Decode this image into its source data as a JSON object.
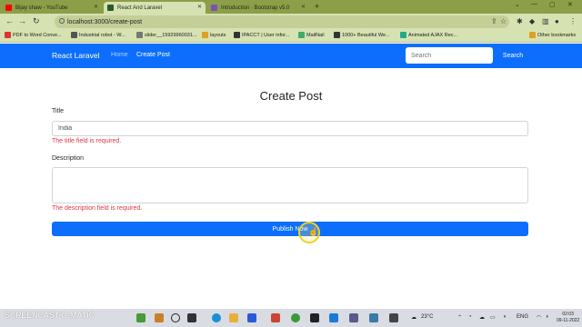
{
  "browser": {
    "tabs": [
      {
        "title": "Bijay shaw - YouTube",
        "favicon_color": "#ff0000"
      },
      {
        "title": "React And Laravel",
        "favicon_color": "#2a5a2a"
      },
      {
        "title": "Introduction · Bootstrap v5.0",
        "favicon_color": "#7952b3"
      }
    ],
    "url": "localhost:3000/create-post",
    "bookmarks": [
      {
        "label": "PDF to Word Conve...",
        "color": "#d33"
      },
      {
        "label": "Industrial robot - W...",
        "color": "#555"
      },
      {
        "label": "slider__15929960031...",
        "color": "#777"
      },
      {
        "label": "layouts",
        "color": "#e0a020"
      },
      {
        "label": "IPACCT | User infor...",
        "color": "#333"
      },
      {
        "label": "MailNail",
        "color": "#4a6"
      },
      {
        "label": "1000+ Beautiful We...",
        "color": "#333"
      },
      {
        "label": "Animated AJAX Rec...",
        "color": "#2a8"
      },
      {
        "label": "Other bookmarks",
        "color": "#e0a020"
      }
    ]
  },
  "navbar": {
    "brand": "React Laravel",
    "links": [
      "Home",
      "Create Post"
    ],
    "search_placeholder": "Search",
    "search_button": "Search"
  },
  "form": {
    "heading": "Create Post",
    "title_label": "Title",
    "title_value": "India",
    "title_error": "The title field is required.",
    "description_label": "Description",
    "description_value": "",
    "description_error": "The description field is required.",
    "submit_label": "Publish Now"
  },
  "watermark": {
    "line1": "RECORDED WITH",
    "line2": "SCREENCAST-O-MATIC"
  },
  "taskbar": {
    "temperature": "23°C",
    "language": "ENG",
    "time": "02:03",
    "date": "09-11-2022"
  },
  "colors": {
    "primary": "#0d6efd",
    "error": "#dc3545",
    "browser_theme": "#d7e2b2"
  }
}
